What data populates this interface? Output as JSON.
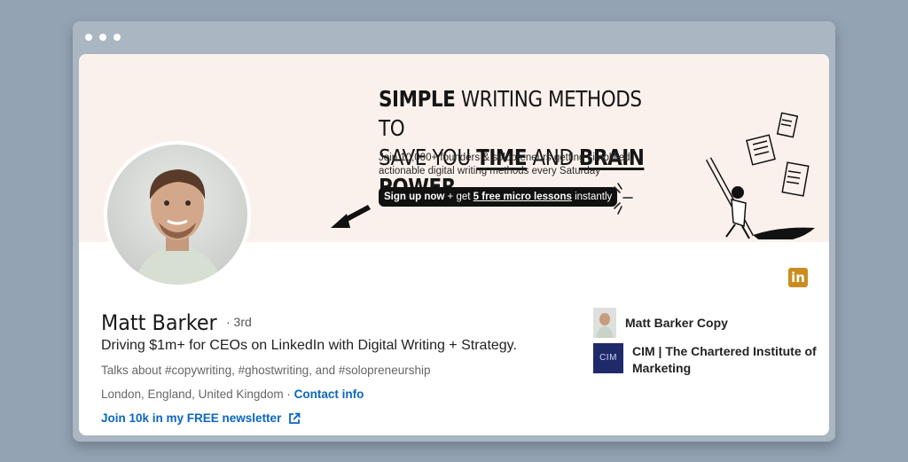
{
  "banner": {
    "headline_line1_bold": "SIMPLE",
    "headline_line1_rest": " WRITING METHODS TO",
    "headline_line2_a": "SAVE YOU ",
    "headline_line2_time": "TIME",
    "headline_line2_and": " AND ",
    "headline_line2_brain": "BRAIN POWER",
    "subtext": "Join 10,000+ founders & solopreneurs getting simplified, actionable digital writing methods every Saturday",
    "cta_bold": "Sign up now",
    "cta_mid": " + get ",
    "cta_link": "5 free micro lessons",
    "cta_end": " instantly"
  },
  "profile": {
    "name": "Matt Barker",
    "degree": "· 3rd",
    "tagline": "Driving $1m+ for CEOs on LinkedIn with Digital Writing + Strategy.",
    "talks": "Talks about #copywriting, #ghostwriting, and #solopreneurship",
    "location": "London, England, United Kingdom · ",
    "contact_label": "Contact info",
    "newsletter_label": "Join 10k in my FREE newsletter"
  },
  "badge": {
    "text": "in",
    "color": "#c98d1f"
  },
  "companies": [
    {
      "name": "Matt Barker Copy",
      "icon": "profile-photo"
    },
    {
      "name": "CIM | The Chartered Institute of Marketing",
      "logo_text": "CIM"
    }
  ],
  "colors": {
    "link": "#0a66c2",
    "banner_bg": "#fbf1ec",
    "page_bg": "#94a3b3"
  }
}
